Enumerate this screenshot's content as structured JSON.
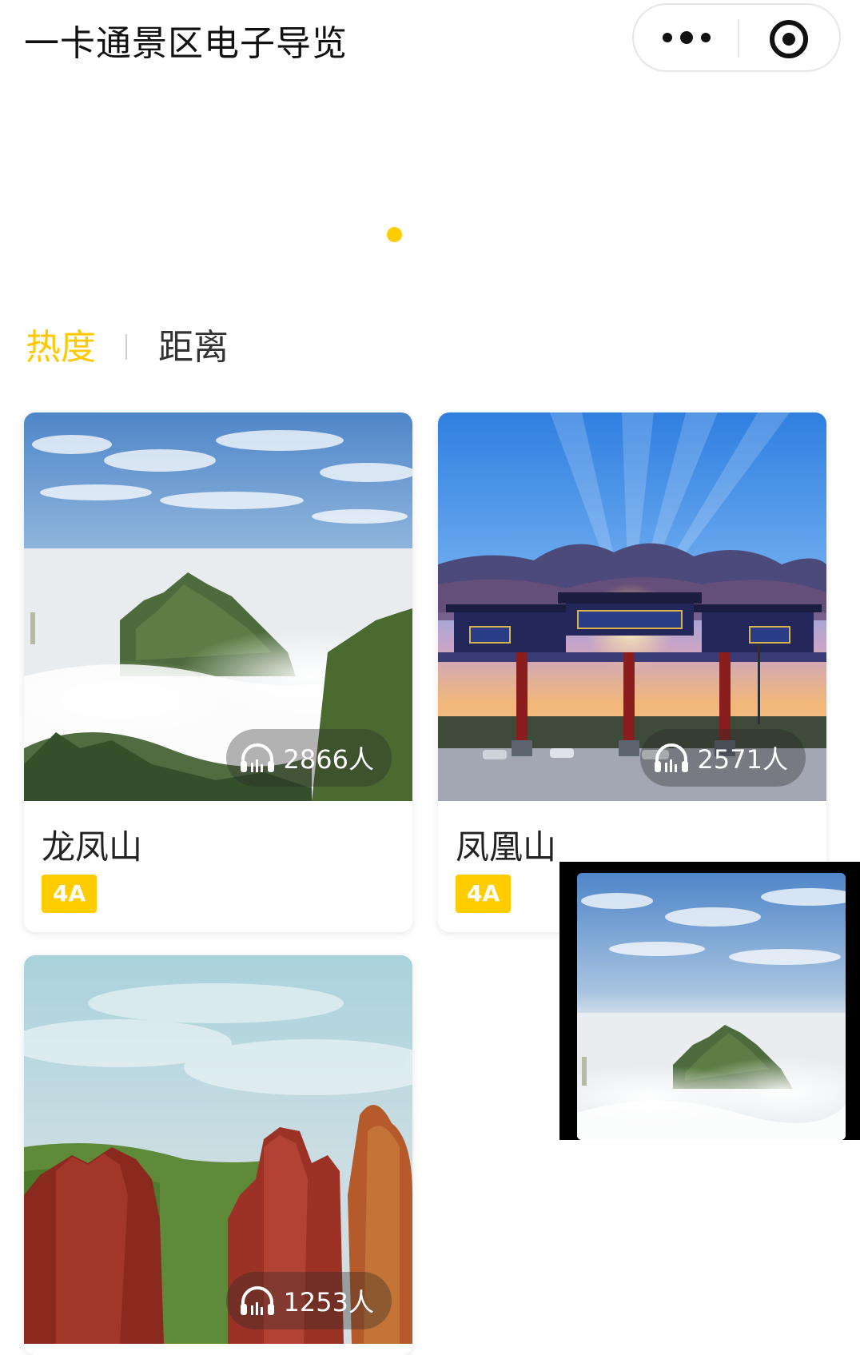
{
  "app": {
    "title": "一卡通景区电子导览"
  },
  "capsule": {
    "more_icon": "more-dots-icon",
    "close_icon": "target-close-icon"
  },
  "banner": {
    "active_indicator_color": "#ffcc00"
  },
  "tabs": [
    {
      "label": "热度",
      "active": true
    },
    {
      "label": "距离",
      "active": false
    }
  ],
  "spots": [
    {
      "name": "龙凤山",
      "badge": "4A",
      "listeners": "2866人",
      "listen_icon": "headphones-icon"
    },
    {
      "name": "凤凰山",
      "badge": "4A",
      "listeners": "2571人",
      "listen_icon": "headphones-icon"
    },
    {
      "name": "",
      "badge": "",
      "listeners": "1253人",
      "listen_icon": "headphones-icon"
    }
  ],
  "colors": {
    "accent": "#ffcc00",
    "active_tab": "#ffc800"
  }
}
